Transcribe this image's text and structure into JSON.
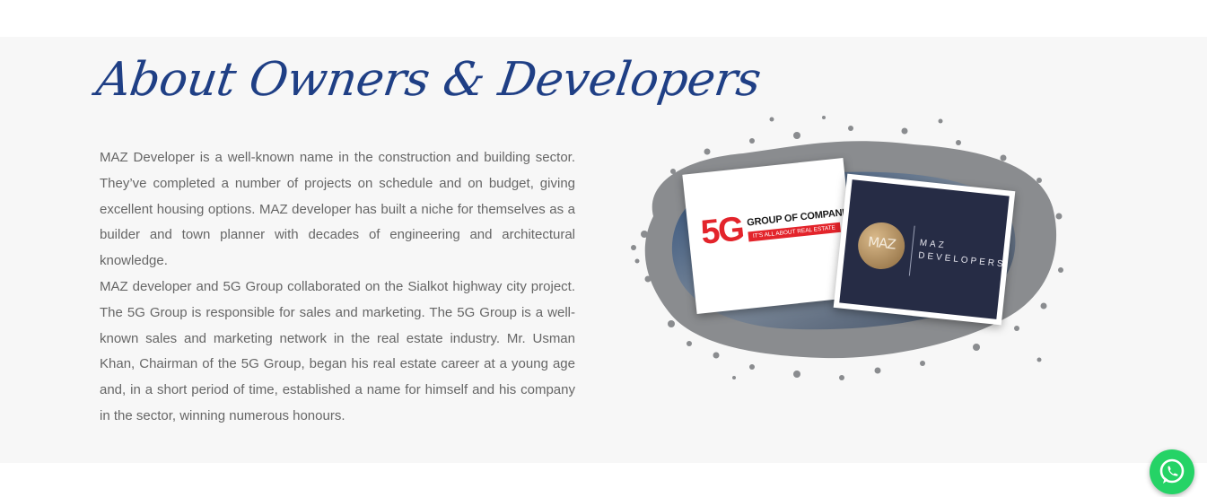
{
  "about": {
    "title": "About Owners & Developers",
    "paragraphs": [
      "MAZ Developer is a well-known name in the construction and building sector. They’ve completed a number of projects on schedule and on budget, giving excellent housing options. MAZ developer has built a niche for themselves as a builder and town planner with decades of engineering and architectural knowledge.",
      "MAZ developer and 5G Group collaborated on the Sialkot highway city project. The 5G Group is responsible for sales and marketing. The 5G Group is a well-known sales and marketing network in the real estate industry. Mr. Usman Khan, Chairman of the 5G Group, began his real estate career at a young age and, in a short period of time, established a name for himself and his company in the sector, winning numerous honours."
    ],
    "logos": {
      "fiveg_mark": "5G",
      "fiveg_name": "GROUP OF COMPANIES",
      "fiveg_tagline": "IT'S ALL ABOUT REAL ESTATE",
      "maz_emblem": "MAZ",
      "maz_name_line1": "MAZ",
      "maz_name_line2": "DEVELOPERS"
    }
  },
  "next_section": {
    "title": ""
  },
  "colors": {
    "heading": "#1f3f85",
    "body_text": "#666666",
    "section_bg": "#f7f7f7",
    "brand_red": "#e3242b",
    "maz_navy": "#262c45",
    "whatsapp_green": "#25d366"
  },
  "icons": {
    "floating_button": "whatsapp-icon"
  }
}
